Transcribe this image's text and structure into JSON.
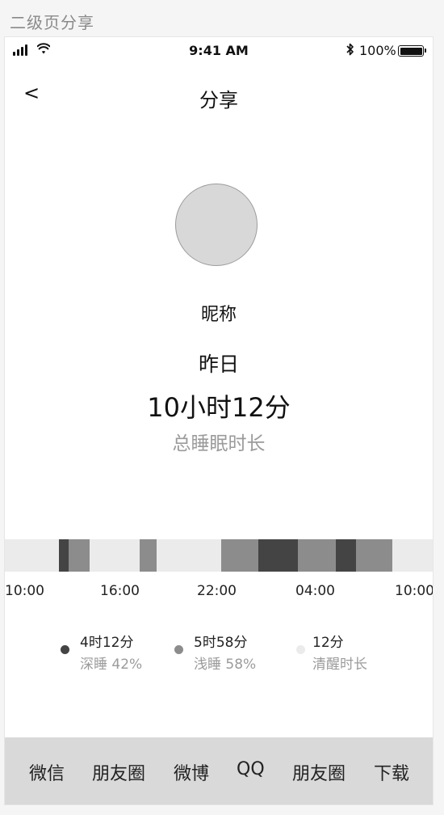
{
  "page_label": "二级页分享",
  "status_bar": {
    "time": "9:41 AM",
    "battery": "100%"
  },
  "nav": {
    "back": "<",
    "title": "分享"
  },
  "profile": {
    "nickname": "昵称"
  },
  "summary": {
    "day": "昨日",
    "duration": "10小时12分",
    "duration_label": "总睡眠时长"
  },
  "timeline": {
    "start": "10:00",
    "end": "10:00",
    "ticks": [
      "10:00",
      "16:00",
      "22:00",
      "04:00",
      "10:00"
    ],
    "stage_colors": {
      "deep": "#444444",
      "light": "#8c8c8c",
      "awake": "#ebebeb"
    },
    "segments": [
      {
        "stage": "deep",
        "start": "13:03",
        "end": "13:34"
      },
      {
        "stage": "light",
        "start": "13:34",
        "end": "14:44"
      },
      {
        "stage": "light",
        "start": "17:33",
        "end": "18:32"
      },
      {
        "stage": "light",
        "start": "22:07",
        "end": "00:12"
      },
      {
        "stage": "deep",
        "start": "00:12",
        "end": "02:26"
      },
      {
        "stage": "light",
        "start": "02:26",
        "end": "04:34"
      },
      {
        "stage": "deep",
        "start": "04:34",
        "end": "05:42"
      },
      {
        "stage": "light",
        "start": "05:42",
        "end": "07:43"
      }
    ]
  },
  "legend": [
    {
      "value": "4时12分",
      "label": "深睡 42%",
      "color": "#444444"
    },
    {
      "value": "5时58分",
      "label": "浅睡 58%",
      "color": "#8c8c8c"
    },
    {
      "value": "12分",
      "label": "清醒时长",
      "color": "#ebebeb"
    }
  ],
  "share": [
    "微信",
    "朋友圈",
    "微博",
    "QQ",
    "朋友圈",
    "下载"
  ]
}
